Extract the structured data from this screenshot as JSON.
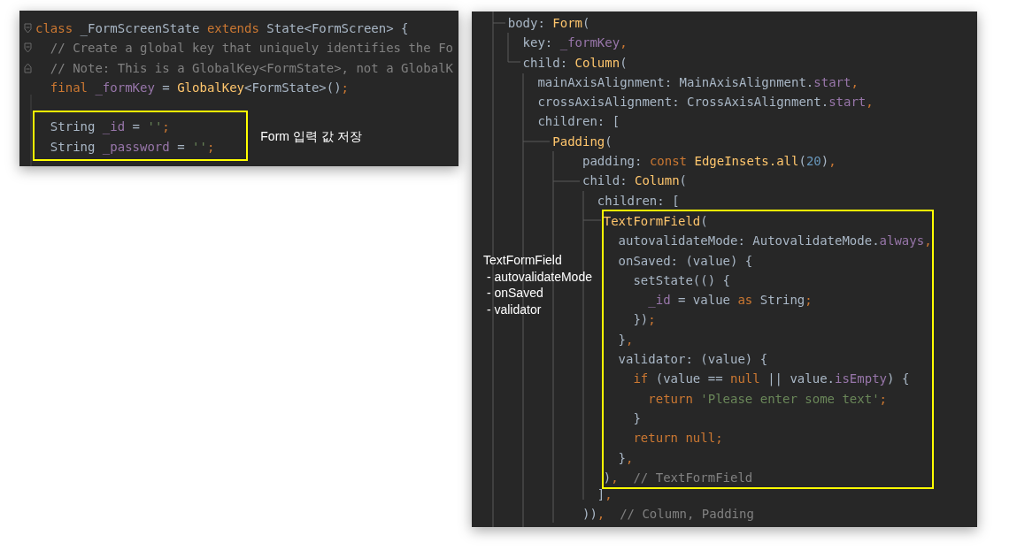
{
  "snippets": [
    {
      "blocks": [
        {
          "boxed": false,
          "lines": [
            {
              "kind": "code",
              "fold_start": true,
              "fold_end": false,
              "tokens": [
                {
                  "kind": "keyword",
                  "text": "class"
                },
                {
                  "kind": "plain",
                  "text": " _FormScreenState "
                },
                {
                  "kind": "keyword",
                  "text": "extends"
                },
                {
                  "kind": "plain",
                  "text": " State<FormScreen> {"
                }
              ]
            },
            {
              "kind": "code",
              "fold_start": true,
              "fold_end": false,
              "tokens": [
                {
                  "kind": "comment",
                  "text": "  // Create a global key that uniquely identifies the Fo"
                }
              ]
            },
            {
              "kind": "code",
              "fold_start": false,
              "fold_end": true,
              "tokens": [
                {
                  "kind": "comment",
                  "text": "  // Note: This is a GlobalKey<FormState>, not a GlobalK"
                }
              ]
            },
            {
              "kind": "code",
              "fold_start": false,
              "fold_end": false,
              "tokens": [
                {
                  "kind": "keyword",
                  "text": "  final"
                },
                {
                  "kind": "field",
                  "text": " _formKey"
                },
                {
                  "kind": "plain",
                  "text": " = "
                },
                {
                  "kind": "type",
                  "text": "GlobalKey"
                },
                {
                  "kind": "plain",
                  "text": "<FormState>()"
                },
                {
                  "kind": "keyword",
                  "text": ";"
                }
              ]
            },
            {
              "kind": "blank",
              "fold_start": false,
              "fold_end": false
            }
          ]
        },
        {
          "boxed": true,
          "note": [
            "Form 입력 값 저장"
          ],
          "lines": [
            {
              "kind": "code",
              "tokens": [
                {
                  "kind": "plain",
                  "text": "  String "
                },
                {
                  "kind": "field",
                  "text": "_id"
                },
                {
                  "kind": "plain",
                  "text": " = "
                },
                {
                  "kind": "string",
                  "text": "''"
                },
                {
                  "kind": "keyword",
                  "text": ";"
                }
              ]
            },
            {
              "kind": "code",
              "tokens": [
                {
                  "kind": "plain",
                  "text": "  String "
                },
                {
                  "kind": "field",
                  "text": "_password"
                },
                {
                  "kind": "plain",
                  "text": " = "
                },
                {
                  "kind": "string",
                  "text": "''"
                },
                {
                  "kind": "keyword",
                  "text": ";"
                }
              ]
            }
          ]
        }
      ]
    },
    {
      "side_note": [
        "TextFormField",
        " - autovalidateMode",
        " - onSaved",
        " - validator"
      ],
      "blocks": [
        {
          "boxed": false,
          "lines": [
            {
              "kind": "code",
              "tokens": [
                {
                  "kind": "plain",
                  "text": "    body: "
                },
                {
                  "kind": "type",
                  "text": "Form"
                },
                {
                  "kind": "plain",
                  "text": "("
                }
              ]
            },
            {
              "kind": "code",
              "tokens": [
                {
                  "kind": "plain",
                  "text": "      key: "
                },
                {
                  "kind": "field",
                  "text": "_formKey"
                },
                {
                  "kind": "keyword",
                  "text": ","
                }
              ]
            },
            {
              "kind": "code",
              "tokens": [
                {
                  "kind": "plain",
                  "text": "      child: "
                },
                {
                  "kind": "type",
                  "text": "Column"
                },
                {
                  "kind": "plain",
                  "text": "("
                }
              ]
            },
            {
              "kind": "code",
              "tokens": [
                {
                  "kind": "plain",
                  "text": "        mainAxisAlignment: MainAxisAlignment."
                },
                {
                  "kind": "field",
                  "text": "start"
                },
                {
                  "kind": "keyword",
                  "text": ","
                }
              ]
            },
            {
              "kind": "code",
              "tokens": [
                {
                  "kind": "plain",
                  "text": "        crossAxisAlignment: CrossAxisAlignment."
                },
                {
                  "kind": "field",
                  "text": "start"
                },
                {
                  "kind": "keyword",
                  "text": ","
                }
              ]
            },
            {
              "kind": "code",
              "tokens": [
                {
                  "kind": "plain",
                  "text": "        children: ["
                }
              ]
            },
            {
              "kind": "code",
              "tokens": [
                {
                  "kind": "type",
                  "text": "          Padding"
                },
                {
                  "kind": "plain",
                  "text": "("
                }
              ]
            },
            {
              "kind": "code",
              "tokens": [
                {
                  "kind": "plain",
                  "text": "              padding: "
                },
                {
                  "kind": "keyword",
                  "text": "const"
                },
                {
                  "kind": "type",
                  "text": " EdgeInsets.all"
                },
                {
                  "kind": "plain",
                  "text": "("
                },
                {
                  "kind": "number",
                  "text": "20"
                },
                {
                  "kind": "plain",
                  "text": ")"
                },
                {
                  "kind": "keyword",
                  "text": ","
                }
              ]
            },
            {
              "kind": "code",
              "tokens": [
                {
                  "kind": "plain",
                  "text": "              child: "
                },
                {
                  "kind": "type",
                  "text": "Column"
                },
                {
                  "kind": "plain",
                  "text": "("
                }
              ]
            },
            {
              "kind": "code",
              "tokens": [
                {
                  "kind": "plain",
                  "text": "                children: ["
                }
              ]
            }
          ]
        },
        {
          "boxed": true,
          "lines": [
            {
              "kind": "code",
              "tokens": [
                {
                  "kind": "type",
                  "text": "                  TextFormField"
                },
                {
                  "kind": "plain",
                  "text": "("
                }
              ]
            },
            {
              "kind": "code",
              "tokens": [
                {
                  "kind": "plain",
                  "text": "                    autovalidateMode: AutovalidateMode."
                },
                {
                  "kind": "field",
                  "text": "always"
                },
                {
                  "kind": "keyword",
                  "text": ","
                }
              ]
            },
            {
              "kind": "code",
              "tokens": [
                {
                  "kind": "plain",
                  "text": "                    onSaved: (value) {"
                }
              ]
            },
            {
              "kind": "code",
              "tokens": [
                {
                  "kind": "plain",
                  "text": "                      setState(() {"
                }
              ]
            },
            {
              "kind": "code",
              "tokens": [
                {
                  "kind": "field",
                  "text": "                        _id"
                },
                {
                  "kind": "plain",
                  "text": " = value "
                },
                {
                  "kind": "keyword",
                  "text": "as"
                },
                {
                  "kind": "plain",
                  "text": " String"
                },
                {
                  "kind": "keyword",
                  "text": ";"
                }
              ]
            },
            {
              "kind": "code",
              "tokens": [
                {
                  "kind": "plain",
                  "text": "                      })"
                },
                {
                  "kind": "keyword",
                  "text": ";"
                }
              ]
            },
            {
              "kind": "code",
              "tokens": [
                {
                  "kind": "plain",
                  "text": "                    }"
                },
                {
                  "kind": "keyword",
                  "text": ","
                }
              ]
            },
            {
              "kind": "code",
              "tokens": [
                {
                  "kind": "plain",
                  "text": "                    validator: (value) {"
                }
              ]
            },
            {
              "kind": "code",
              "tokens": [
                {
                  "kind": "keyword",
                  "text": "                      if"
                },
                {
                  "kind": "plain",
                  "text": " (value == "
                },
                {
                  "kind": "keyword",
                  "text": "null"
                },
                {
                  "kind": "plain",
                  "text": " || value."
                },
                {
                  "kind": "field",
                  "text": "isEmpty"
                },
                {
                  "kind": "plain",
                  "text": ") {"
                }
              ]
            },
            {
              "kind": "code",
              "tokens": [
                {
                  "kind": "keyword",
                  "text": "                        return "
                },
                {
                  "kind": "string",
                  "text": "'Please enter some text'"
                },
                {
                  "kind": "keyword",
                  "text": ";"
                }
              ]
            },
            {
              "kind": "code",
              "tokens": [
                {
                  "kind": "plain",
                  "text": "                      }"
                }
              ]
            },
            {
              "kind": "code",
              "tokens": [
                {
                  "kind": "keyword",
                  "text": "                      return null;"
                }
              ]
            },
            {
              "kind": "code",
              "tokens": [
                {
                  "kind": "plain",
                  "text": "                    }"
                },
                {
                  "kind": "keyword",
                  "text": ","
                }
              ]
            },
            {
              "kind": "code",
              "tokens": [
                {
                  "kind": "plain",
                  "text": "                  )"
                },
                {
                  "kind": "keyword",
                  "text": ","
                },
                {
                  "kind": "comment",
                  "text": "  // TextFormField"
                }
              ]
            }
          ]
        },
        {
          "boxed": false,
          "lines": [
            {
              "kind": "code",
              "tokens": [
                {
                  "kind": "plain",
                  "text": "                ]"
                },
                {
                  "kind": "keyword",
                  "text": ","
                }
              ]
            },
            {
              "kind": "code",
              "tokens": [
                {
                  "kind": "plain",
                  "text": "              ))"
                },
                {
                  "kind": "keyword",
                  "text": ","
                },
                {
                  "kind": "comment",
                  "text": "  // Column, Padding"
                }
              ]
            }
          ]
        }
      ]
    }
  ]
}
